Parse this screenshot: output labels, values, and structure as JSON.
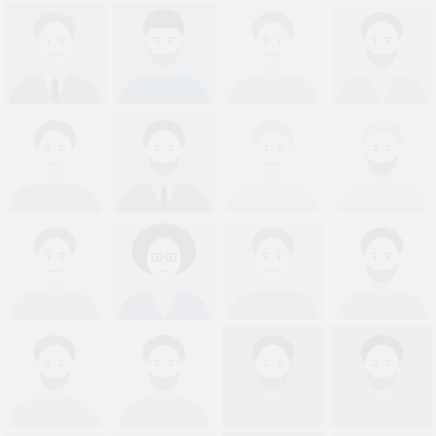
{
  "gallery": {
    "background": "#f2f3f2",
    "tiles": [
      {
        "bg": "#eceeed",
        "shirt": "#e2e4e3",
        "hair": "#e0e1df",
        "tie": true,
        "beard": false,
        "glasses": false,
        "hat": false,
        "afro": false,
        "suit": true
      },
      {
        "bg": "#e9eef2",
        "shirt": "#dfe6ec",
        "hair": "#d9dcdc",
        "tie": false,
        "beard": true,
        "glasses": false,
        "hat": true,
        "afro": false,
        "suit": false
      },
      {
        "bg": "#f0f1f0",
        "shirt": "#ebeceb",
        "hair": "#e3e3e0",
        "tie": false,
        "beard": false,
        "glasses": false,
        "hat": false,
        "afro": false,
        "suit": false
      },
      {
        "bg": "#eef0ef",
        "shirt": "#e6e8e7",
        "hair": "#dedfdc",
        "tie": false,
        "beard": true,
        "glasses": false,
        "hat": false,
        "afro": false,
        "suit": true
      },
      {
        "bg": "#f0f1ef",
        "shirt": "#e8e9e5",
        "hair": "#e2e1dc",
        "tie": false,
        "beard": false,
        "glasses": false,
        "hat": false,
        "afro": false,
        "suit": false
      },
      {
        "bg": "#eceeed",
        "shirt": "#e0e2e2",
        "hair": "#dcdcda",
        "tie": true,
        "beard": true,
        "glasses": false,
        "hat": false,
        "afro": false,
        "suit": true
      },
      {
        "bg": "#f1f2f1",
        "shirt": "#ebedec",
        "hair": "#e9e9e7",
        "tie": false,
        "beard": false,
        "glasses": false,
        "hat": false,
        "afro": false,
        "suit": false
      },
      {
        "bg": "#f2f2ef",
        "shirt": "#ededea",
        "hair": "#ecebe6",
        "tie": false,
        "beard": true,
        "glasses": false,
        "hat": false,
        "afro": false,
        "suit": false
      },
      {
        "bg": "#f1f2f1",
        "shirt": "#eaeceb",
        "hair": "#e1e1df",
        "tie": false,
        "beard": false,
        "glasses": false,
        "hat": false,
        "afro": false,
        "suit": false
      },
      {
        "bg": "#eef0f0",
        "shirt": "#e2e5ea",
        "hair": "#dcdad6",
        "tie": false,
        "beard": false,
        "glasses": true,
        "hat": false,
        "afro": true,
        "suit": true
      },
      {
        "bg": "#edf0f2",
        "shirt": "#e6e9ec",
        "hair": "#dfe0df",
        "tie": false,
        "beard": false,
        "glasses": false,
        "hat": false,
        "afro": false,
        "suit": false
      },
      {
        "bg": "#f0f1f0",
        "shirt": "#e9ebea",
        "hair": "#dcdcd9",
        "tie": false,
        "beard": true,
        "glasses": false,
        "hat": false,
        "afro": false,
        "suit": false
      },
      {
        "bg": "#f0f1f0",
        "shirt": "#e8eae9",
        "hair": "#dedfdc",
        "tie": false,
        "beard": true,
        "glasses": false,
        "hat": false,
        "afro": false,
        "suit": false
      },
      {
        "bg": "#eff1f0",
        "shirt": "#e7e9e7",
        "hair": "#dcdcd8",
        "tie": false,
        "beard": true,
        "glasses": false,
        "hat": false,
        "afro": false,
        "suit": false
      },
      {
        "bg": "#e8ebee",
        "shirt": "#e4e8ed",
        "hair": "#dad9d4",
        "tie": false,
        "beard": true,
        "glasses": false,
        "hat": false,
        "afro": false,
        "suit": false
      },
      {
        "bg": "#eaeceb",
        "shirt": "#e6e8e8",
        "hair": "#d9d7d2",
        "tie": false,
        "beard": true,
        "glasses": false,
        "hat": false,
        "afro": false,
        "suit": false
      }
    ]
  }
}
